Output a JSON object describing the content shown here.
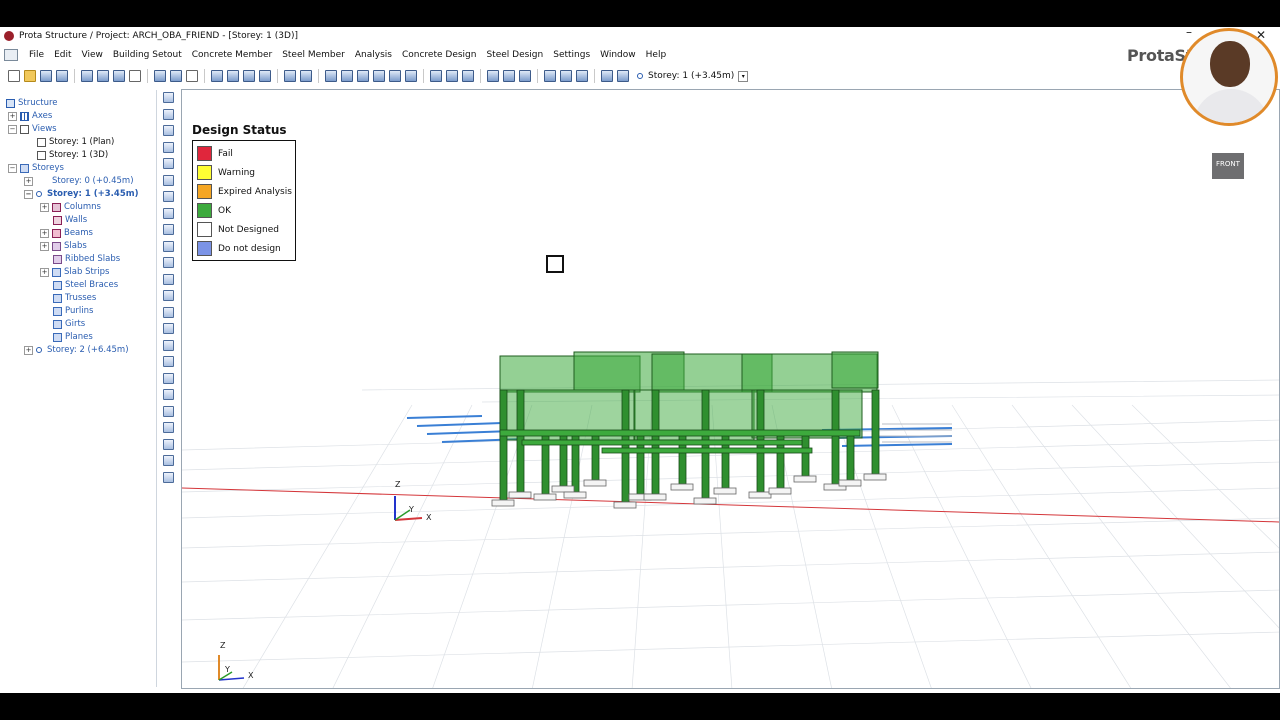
{
  "window": {
    "title": "Prota Structure / Project: ARCH_OBA_FRIEND - [Storey: 1 (3D)]",
    "close": "✕",
    "minimize": "–"
  },
  "menu": [
    "File",
    "Edit",
    "View",
    "Building Setout",
    "Concrete Member",
    "Steel Member",
    "Analysis",
    "Concrete Design",
    "Steel Design",
    "Settings",
    "Window",
    "Help"
  ],
  "brand": "ProtaSt",
  "toolbar": {
    "storey_selector": "Storey: 1 (+3.45m)",
    "dropdown_glyph": "▾"
  },
  "tree": {
    "root": "Structure",
    "axes": "Axes",
    "views": "Views",
    "view_items": [
      "Storey: 1 (Plan)",
      "Storey: 1 (3D)"
    ],
    "storeys": "Storeys",
    "storey0": "Storey: 0 (+0.45m)",
    "storey1": "Storey: 1 (+3.45m)",
    "storey1_children": [
      "Columns",
      "Walls",
      "Beams",
      "Slabs",
      "Ribbed Slabs",
      "Slab Strips",
      "Steel Braces",
      "Trusses",
      "Purlins",
      "Girts",
      "Planes"
    ],
    "storey2": "Storey: 2 (+6.45m)",
    "expand_plus": "+",
    "expand_minus": "−"
  },
  "legend": {
    "title": "Design Status",
    "items": [
      {
        "label": "Fail",
        "color": "#e0263c"
      },
      {
        "label": "Warning",
        "color": "#ffff33"
      },
      {
        "label": "Expired Analysis",
        "color": "#f5a623"
      },
      {
        "label": "OK",
        "color": "#3daa3d"
      },
      {
        "label": "Not Designed",
        "color": "#ffffff"
      },
      {
        "label": "Do not design",
        "color": "#7b93e6"
      }
    ]
  },
  "axes_labels": {
    "x": "X",
    "y": "Y",
    "z": "Z"
  },
  "view_cube": {
    "face": "FRONT"
  },
  "colors": {
    "ok_green": "#3daa3d",
    "ground_grid": "#d9dde3",
    "x_axis_red": "#d4363a",
    "slab_blue": "#3a7fd5"
  }
}
